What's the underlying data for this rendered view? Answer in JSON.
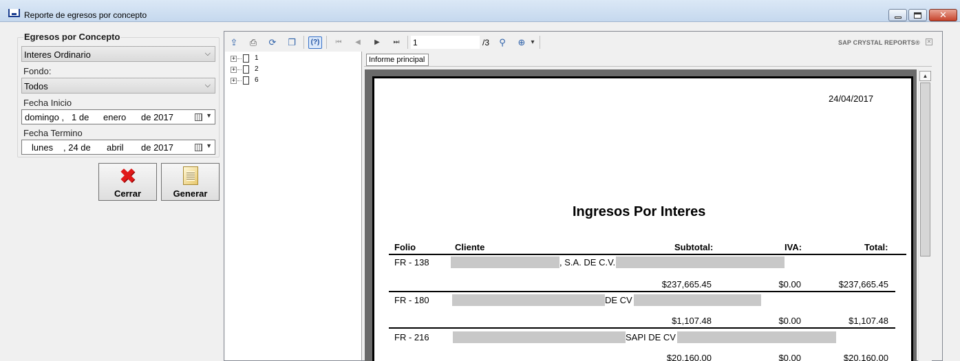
{
  "window": {
    "title": "Reporte de egresos por concepto",
    "close_glyph": "✕"
  },
  "form": {
    "group_title": "Egresos por Concepto",
    "concepto_value": "Interes Ordinario",
    "fondo_label": "Fondo:",
    "fondo_value": "Todos",
    "fecha_inicio_label": "Fecha Inicio",
    "fecha_inicio": {
      "weekday": "domingo ,",
      "day": "1 de",
      "month": "enero",
      "year": "de 2017"
    },
    "fecha_termino_label": "Fecha Termino",
    "fecha_termino": {
      "weekday": "lunes",
      "day": ", 24 de",
      "month": "abril",
      "year": "de 2017"
    },
    "dropdown_glyph": "⌵",
    "cerrar_label": "Cerrar",
    "generar_label": "Generar",
    "cerrar_glyph": "✖"
  },
  "viewer": {
    "page_input_value": "1",
    "page_total": "/3",
    "brand": "SAP CRYSTAL REPORTS®",
    "brand_close": "✕",
    "help_glyph": "(?)",
    "tab_label": "Informe principal",
    "tree_plus": "+",
    "tree_items": [
      "1",
      "2",
      "6"
    ],
    "icons": {
      "export": "⇪",
      "print": "⎙",
      "refresh": "⟳",
      "copy": "❐",
      "first": "⏮",
      "prev": "◀",
      "next": "▶",
      "last": "⏭",
      "find": "⚲",
      "zoom": "⊕",
      "zoom_arrow": "▾",
      "scroll_up": "▲"
    }
  },
  "report": {
    "date": "24/04/2017",
    "title": "Ingresos Por Interes",
    "headers": {
      "folio": "Folio",
      "cliente": "Cliente",
      "subtotal": "Subtotal:",
      "iva": "IVA:",
      "total": "Total:"
    },
    "rows": [
      {
        "folio": "FR - 138",
        "cliente_visible": ", S.A. DE C.V.",
        "subtotal": "$237,665.45",
        "iva": "$0.00",
        "total": "$237,665.45"
      },
      {
        "folio": "FR - 180",
        "cliente_visible": "DE CV I",
        "subtotal": "$1,107.48",
        "iva": "$0.00",
        "total": "$1,107.48"
      },
      {
        "folio": "FR - 216",
        "cliente_visible": "SAPI DE CV",
        "subtotal": "$20,160.00",
        "iva": "$0.00",
        "total": "$20,160.00"
      }
    ]
  }
}
